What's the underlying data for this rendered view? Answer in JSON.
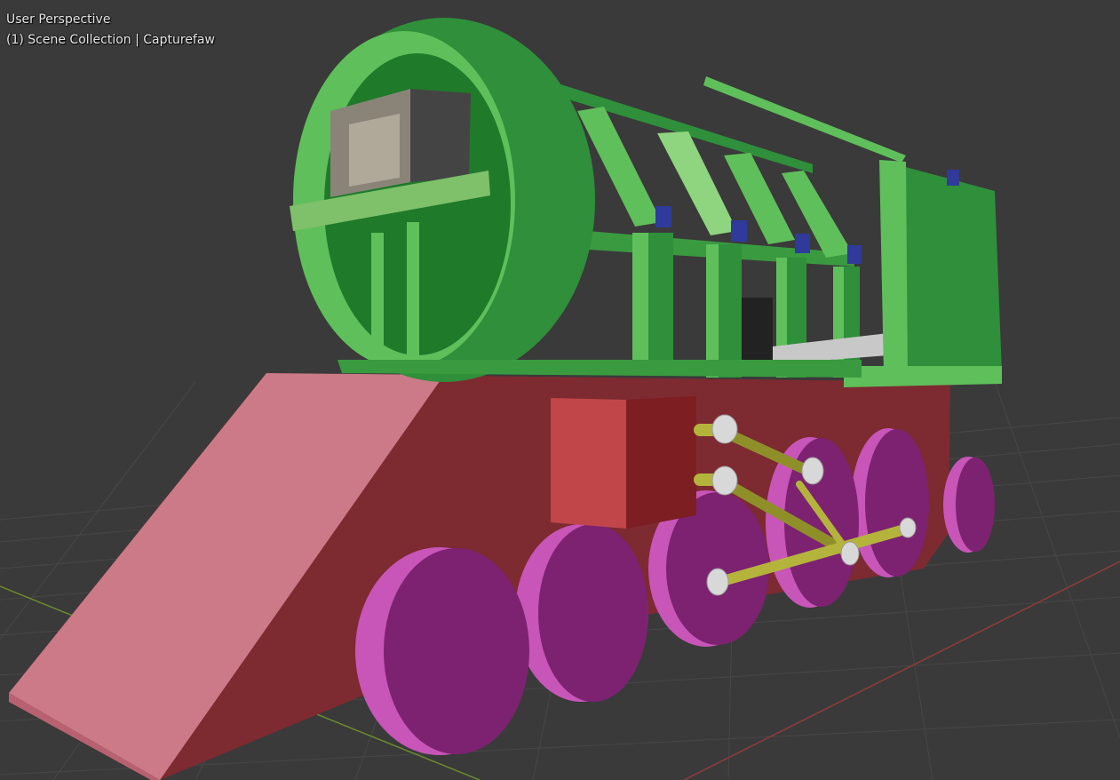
{
  "viewport": {
    "view_name": "User Perspective",
    "collection_info": "(1) Scene Collection | Capturefaw"
  },
  "colors": {
    "background": "#3a3a3a",
    "grid_line": "#474747",
    "x_axis": "#8f3b3b",
    "y_axis": "#6b8a2e",
    "boiler_green": "#5fbf5a",
    "frame_dark_green": "#2f8f3a",
    "body_red": "#7d2a30",
    "ramp_pink": "#cc7a87",
    "wheel_magenta": "#9b2f8f",
    "rod_yellow": "#b4b43c",
    "bolt_blue": "#2f3a9b",
    "cylinder_box_red": "#c0464a"
  }
}
